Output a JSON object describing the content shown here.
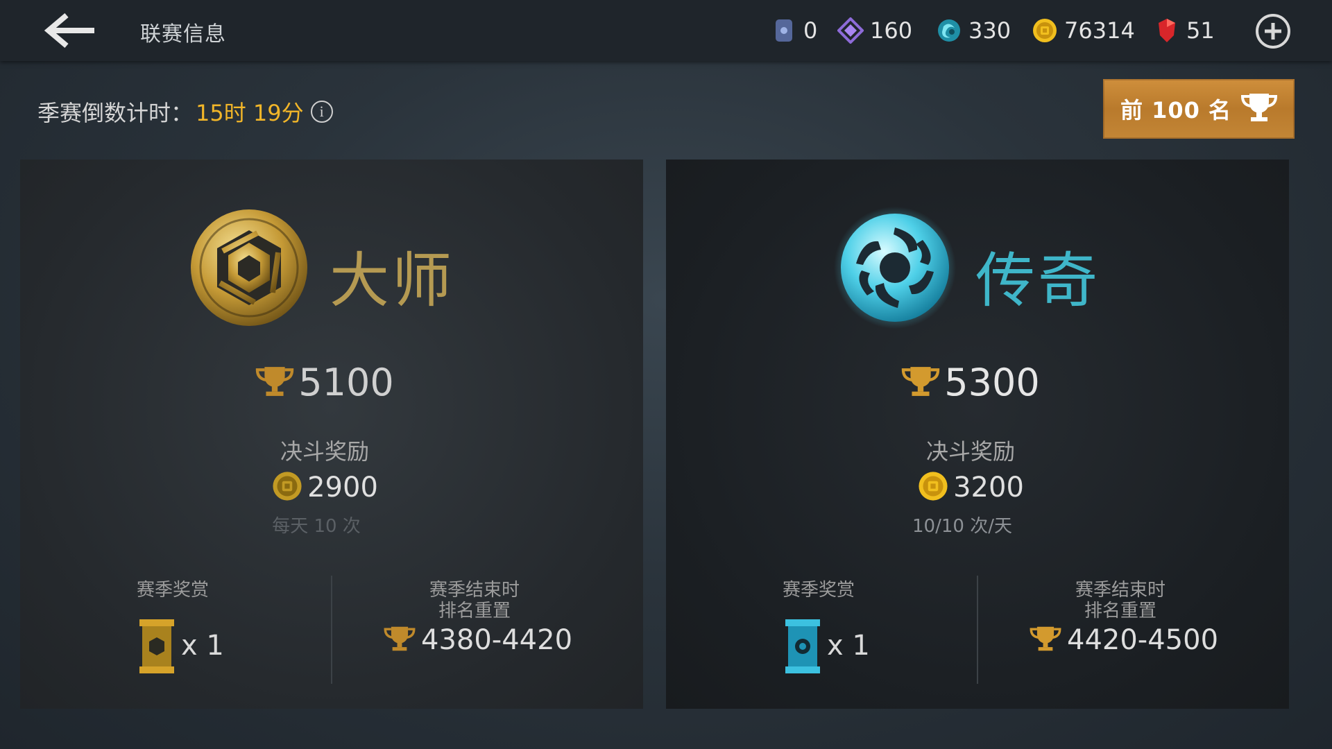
{
  "header": {
    "title": "联赛信息",
    "currencies": [
      {
        "name": "card",
        "value": "0"
      },
      {
        "name": "crystal",
        "value": "160"
      },
      {
        "name": "orb",
        "value": "330"
      },
      {
        "name": "gold",
        "value": "76314"
      },
      {
        "name": "gem",
        "value": "51"
      }
    ]
  },
  "season": {
    "label": "季赛倒数计时：",
    "time": "15时 19分"
  },
  "top100": {
    "label": "前 100 名"
  },
  "leagues": [
    {
      "rank_name": "大师",
      "trophies": "5100",
      "duel_label": "决斗奖励",
      "duel_reward": "2900",
      "duel_note": "每天 10 次",
      "season_reward_label": "赛季奖赏",
      "chest_qty": "x 1",
      "reset_label_line1": "赛季结束时",
      "reset_label_line2": "排名重置",
      "reset_range": "4380-4420",
      "accent": "#b59a52"
    },
    {
      "rank_name": "传奇",
      "trophies": "5300",
      "duel_label": "决斗奖励",
      "duel_reward": "3200",
      "duel_note": "10/10 次/天",
      "season_reward_label": "赛季奖赏",
      "chest_qty": "x 1",
      "reset_label_line1": "赛季结束时",
      "reset_label_line2": "排名重置",
      "reset_range": "4420-4500",
      "accent": "#3fb6c9"
    }
  ]
}
